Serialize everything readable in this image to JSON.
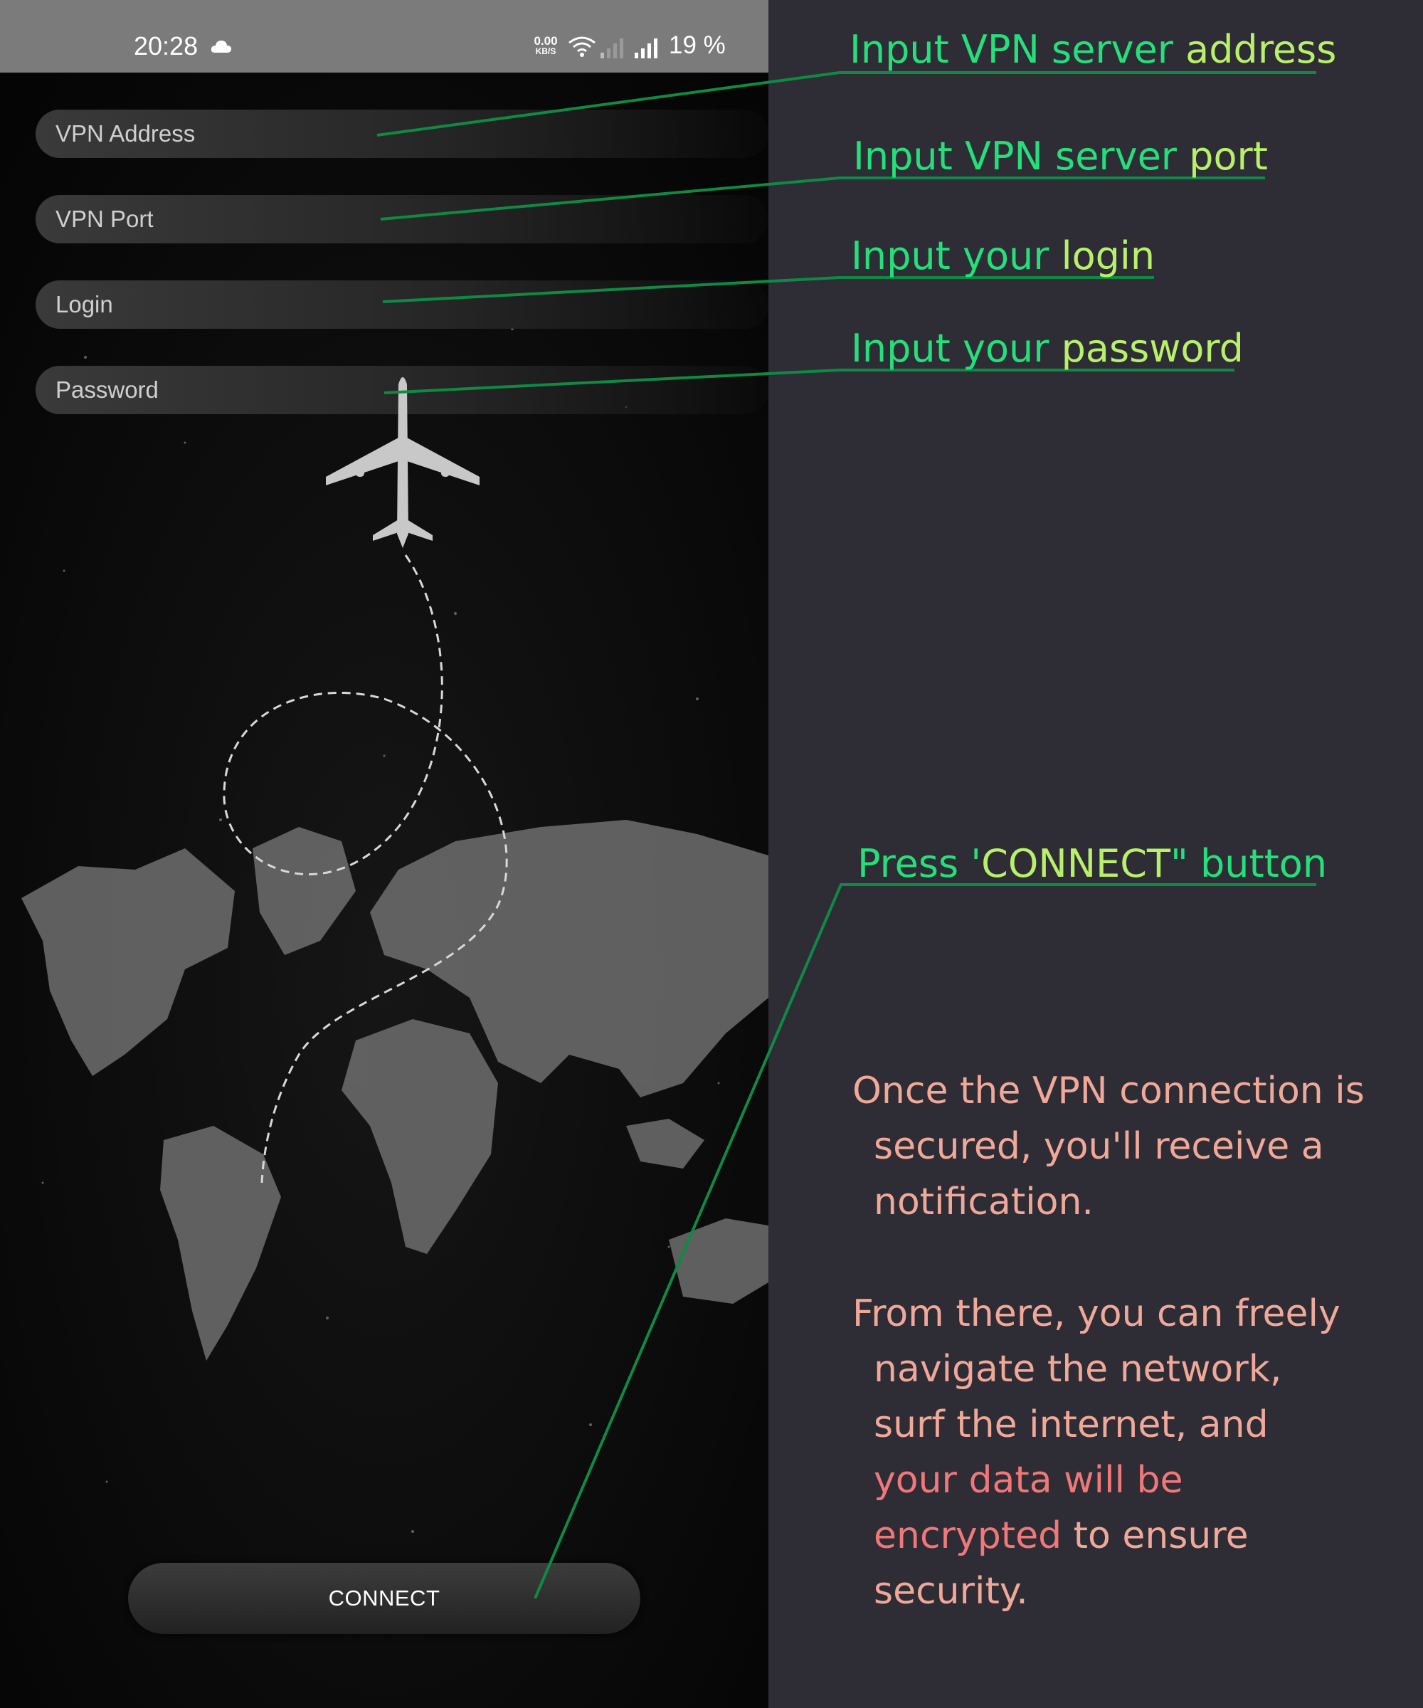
{
  "status_bar": {
    "time": "20:28",
    "net_speed": "0.00",
    "net_speed_unit": "KB/S",
    "battery": "19 %"
  },
  "form": {
    "vpn_address_placeholder": "VPN Address",
    "vpn_port_placeholder": "VPN Port",
    "login_placeholder": "Login",
    "password_placeholder": "Password",
    "connect_label": "CONNECT"
  },
  "annotations": {
    "address": {
      "part1": "Input VPN server ",
      "part2": "address"
    },
    "port": {
      "part1": "Input VPN server ",
      "part2": "port"
    },
    "login": {
      "part1": "Input your ",
      "part2": "login"
    },
    "password": {
      "part1": "Input your ",
      "part2": "password"
    },
    "connect": {
      "part1": "Press '",
      "part2": "CONNECT",
      "part3": "\" button"
    }
  },
  "notes": {
    "p1_line1": "Once the VPN connection is",
    "p1_line2": "secured, you'll receive a",
    "p1_line3": "notification.",
    "p2_line1": "From there, you can freely",
    "p2_line2": "navigate the network,",
    "p2_line3": "surf the internet, and",
    "p2_line4": "your data will be",
    "p2_line5a": "encrypted",
    "p2_line5b": " to ensure",
    "p2_line6": "security."
  },
  "colors": {
    "annotation_green": "#25e07a",
    "annotation_lime": "#b8f06a",
    "note_text": "#f0a898",
    "note_highlight": "#f07878",
    "leader_line": "#0f8a45"
  },
  "icons": [
    "cloud-icon",
    "wifi-icon",
    "signal-icon",
    "airplane-icon"
  ]
}
